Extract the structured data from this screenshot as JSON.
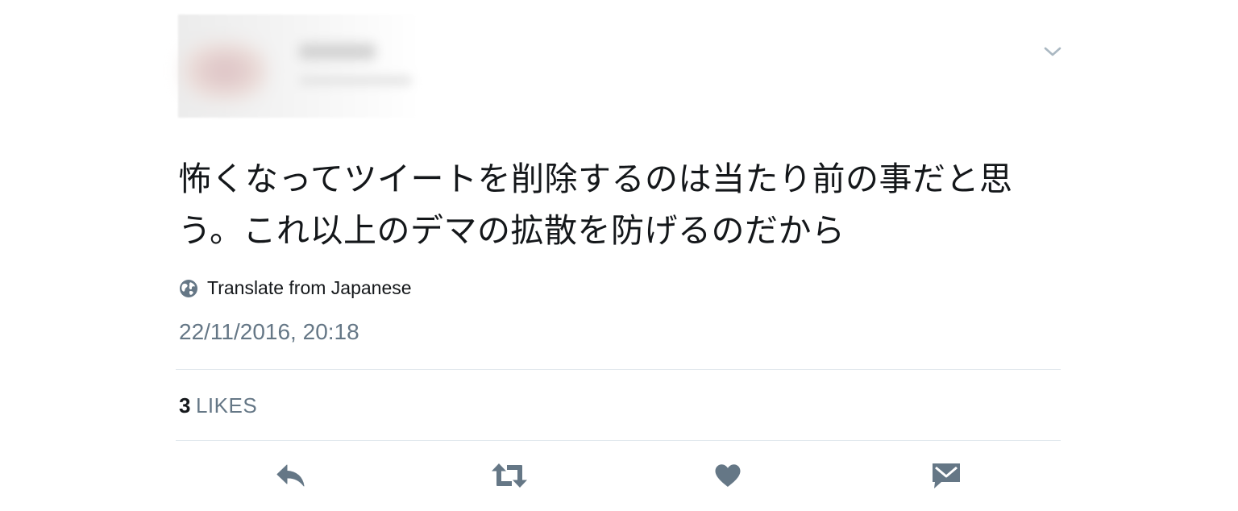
{
  "tweet": {
    "text": "怖くなってツイートを削除するのは当たり前の事だと思う。これ以上のデマの拡散を防げるのだから",
    "translate_label": "Translate from Japanese",
    "timestamp": "22/11/2016, 20:18",
    "likes_count": "3",
    "likes_label": "LIKES"
  },
  "icons": {
    "more": "chevron-down-icon",
    "translate": "globe-icon",
    "reply": "reply-icon",
    "retweet": "retweet-icon",
    "like": "heart-icon",
    "message": "envelope-icon"
  },
  "colors": {
    "text": "#14171a",
    "secondary": "#657786",
    "icon": "#657786",
    "divider": "#e1e8ed",
    "caret": "#aab8c2"
  }
}
